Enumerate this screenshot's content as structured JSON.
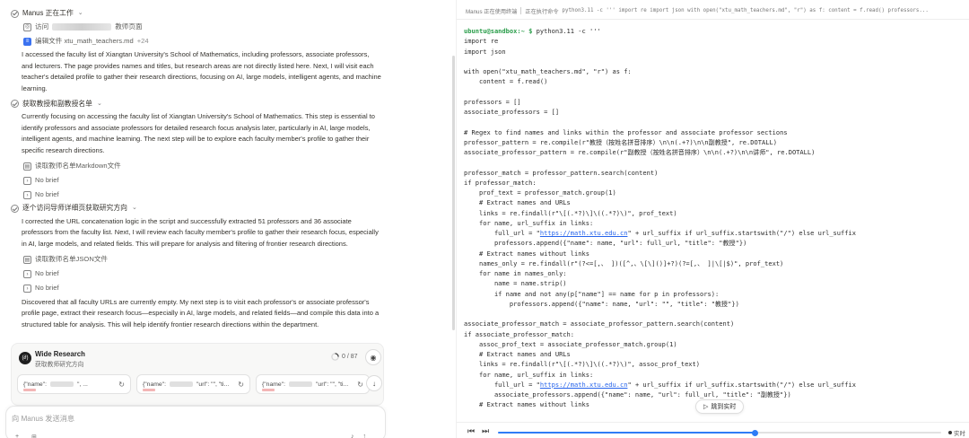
{
  "chat": {
    "working_title": "Manus 正在工作",
    "tool_visit_prefix": "访问",
    "tool_visit_suffix": "教师页面",
    "tool_edit": "编辑文件 xtu_math_teachers.md",
    "tool_edit_count": "+24",
    "para1": "I accessed the faculty list of Xiangtan University's School of Mathematics, including professors, associate professors, and lecturers. The page provides names and titles, but research areas are not directly listed here. Next, I will visit each teacher's detailed profile to gather their research directions, focusing on AI, large models, intelligent agents, and machine learning.",
    "step2_title": "获取教授和副教授名单",
    "para2": "Currently focusing on accessing the faculty list of Xiangtan University's School of Mathematics. This step is essential to identify professors and associate professors for detailed research focus analysis later, particularly in AI, large models, intelligent agents, and machine learning. The next step will be to explore each faculty member's profile to gather their specific research directions.",
    "tool_read_md": "读取教师名单Markdown文件",
    "no_brief": "No brief",
    "step3_title": "逐个访问导师详细页获取研究方向",
    "para3": "I corrected the URL concatenation logic in the script and successfully extracted 51 professors and 36 associate professors from the faculty list. Next, I will review each faculty member's profile to gather their research focus, especially in AI, large models, and related fields. This will prepare for analysis and filtering of frontier research directions.",
    "tool_read_json": "读取教师名单JSON文件",
    "para4": "Discovered that all faculty URLs are currently empty. My next step is to visit each professor's or associate professor's profile page, extract their research focus—especially in AI, large models, and related fields—and compile this data into a structured table for analysis. This will help identify frontier research directions within the department."
  },
  "wide_research": {
    "logo": "(∂)",
    "title": "Wide Research",
    "subtitle": "获取教师研究方向",
    "progress": "0 / 87",
    "progress_fraction": 0.0,
    "items": [
      {
        "left": "{\"name\":",
        "right": "\", ..."
      },
      {
        "left": "{\"name\":",
        "right": "\"url\": \"\", \"ti..."
      },
      {
        "left": "{\"name\":",
        "right": "\"url\": \"\", \"ti..."
      }
    ]
  },
  "input": {
    "placeholder": "向 Manus 发送消息"
  },
  "terminal": {
    "status_using": "Manus 正在使用终端",
    "status_cmd_label": "正在执行命令",
    "status_cmd": "python3.11 -c ''' import re import json with open(\"xtu_math_teachers.md\", \"r\") as f: content = f.read() professors...",
    "prompt": "ubuntu@sandbox:~ $",
    "command": " python3.11 -c '''",
    "code_lines": [
      "import re",
      "import json",
      "",
      "with open(\"xtu_math_teachers.md\", \"r\") as f:",
      "    content = f.read()",
      "",
      "professors = []",
      "associate_professors = []",
      "",
      "# Regex to find names and links within the professor and associate professor sections",
      "professor_pattern = re.compile(r\"教授（按姓名拼音排序）\\n\\n(.+?)\\n\\n副教授\", re.DOTALL)",
      "associate_professor_pattern = re.compile(r\"副教授（按姓名拼音排序）\\n\\n(.+?)\\n\\n讲师\", re.DOTALL)",
      "",
      "professor_match = professor_pattern.search(content)",
      "if professor_match:",
      "    prof_text = professor_match.group(1)",
      "    # Extract names and URLs",
      "    links = re.findall(r\"\\[(.*?)\\]\\((.*?)\\)\", prof_text)",
      "    for name, url_suffix in links:",
      "        full_url = \"LINK\" + url_suffix if url_suffix.startswith(\"/\") else url_suffix",
      "        professors.append({\"name\": name, \"url\": full_url, \"title\": \"教授\"})",
      "    # Extract names without links",
      "    names_only = re.findall(r\"(?<=[,、 ])([^,、\\[\\]()]+?)(?=[,、 ]|\\[|$)\", prof_text)",
      "    for name in names_only:",
      "        name = name.strip()",
      "        if name and not any(p[\"name\"] == name for p in professors):",
      "            professors.append({\"name\": name, \"url\": \"\", \"title\": \"教授\"})",
      "",
      "associate_professor_match = associate_professor_pattern.search(content)",
      "if associate_professor_match:",
      "    assoc_prof_text = associate_professor_match.group(1)",
      "    # Extract names and URLs",
      "    links = re.findall(r\"\\[(.*?)\\]\\((.*?)\\)\", assoc_prof_text)",
      "    for name, url_suffix in links:",
      "        full_url = \"LINK\" + url_suffix if url_suffix.startswith(\"/\") else url_suffix",
      "        associate_professors.append({\"name\": name, \"url\": full_url, \"title\": \"副教授\"})",
      "    # Extract names without links"
    ],
    "link_text": "https://math.xtu.edu.cn",
    "jump_live": "跳到实时",
    "live_label": "实时",
    "playback_fraction": 0.58
  }
}
